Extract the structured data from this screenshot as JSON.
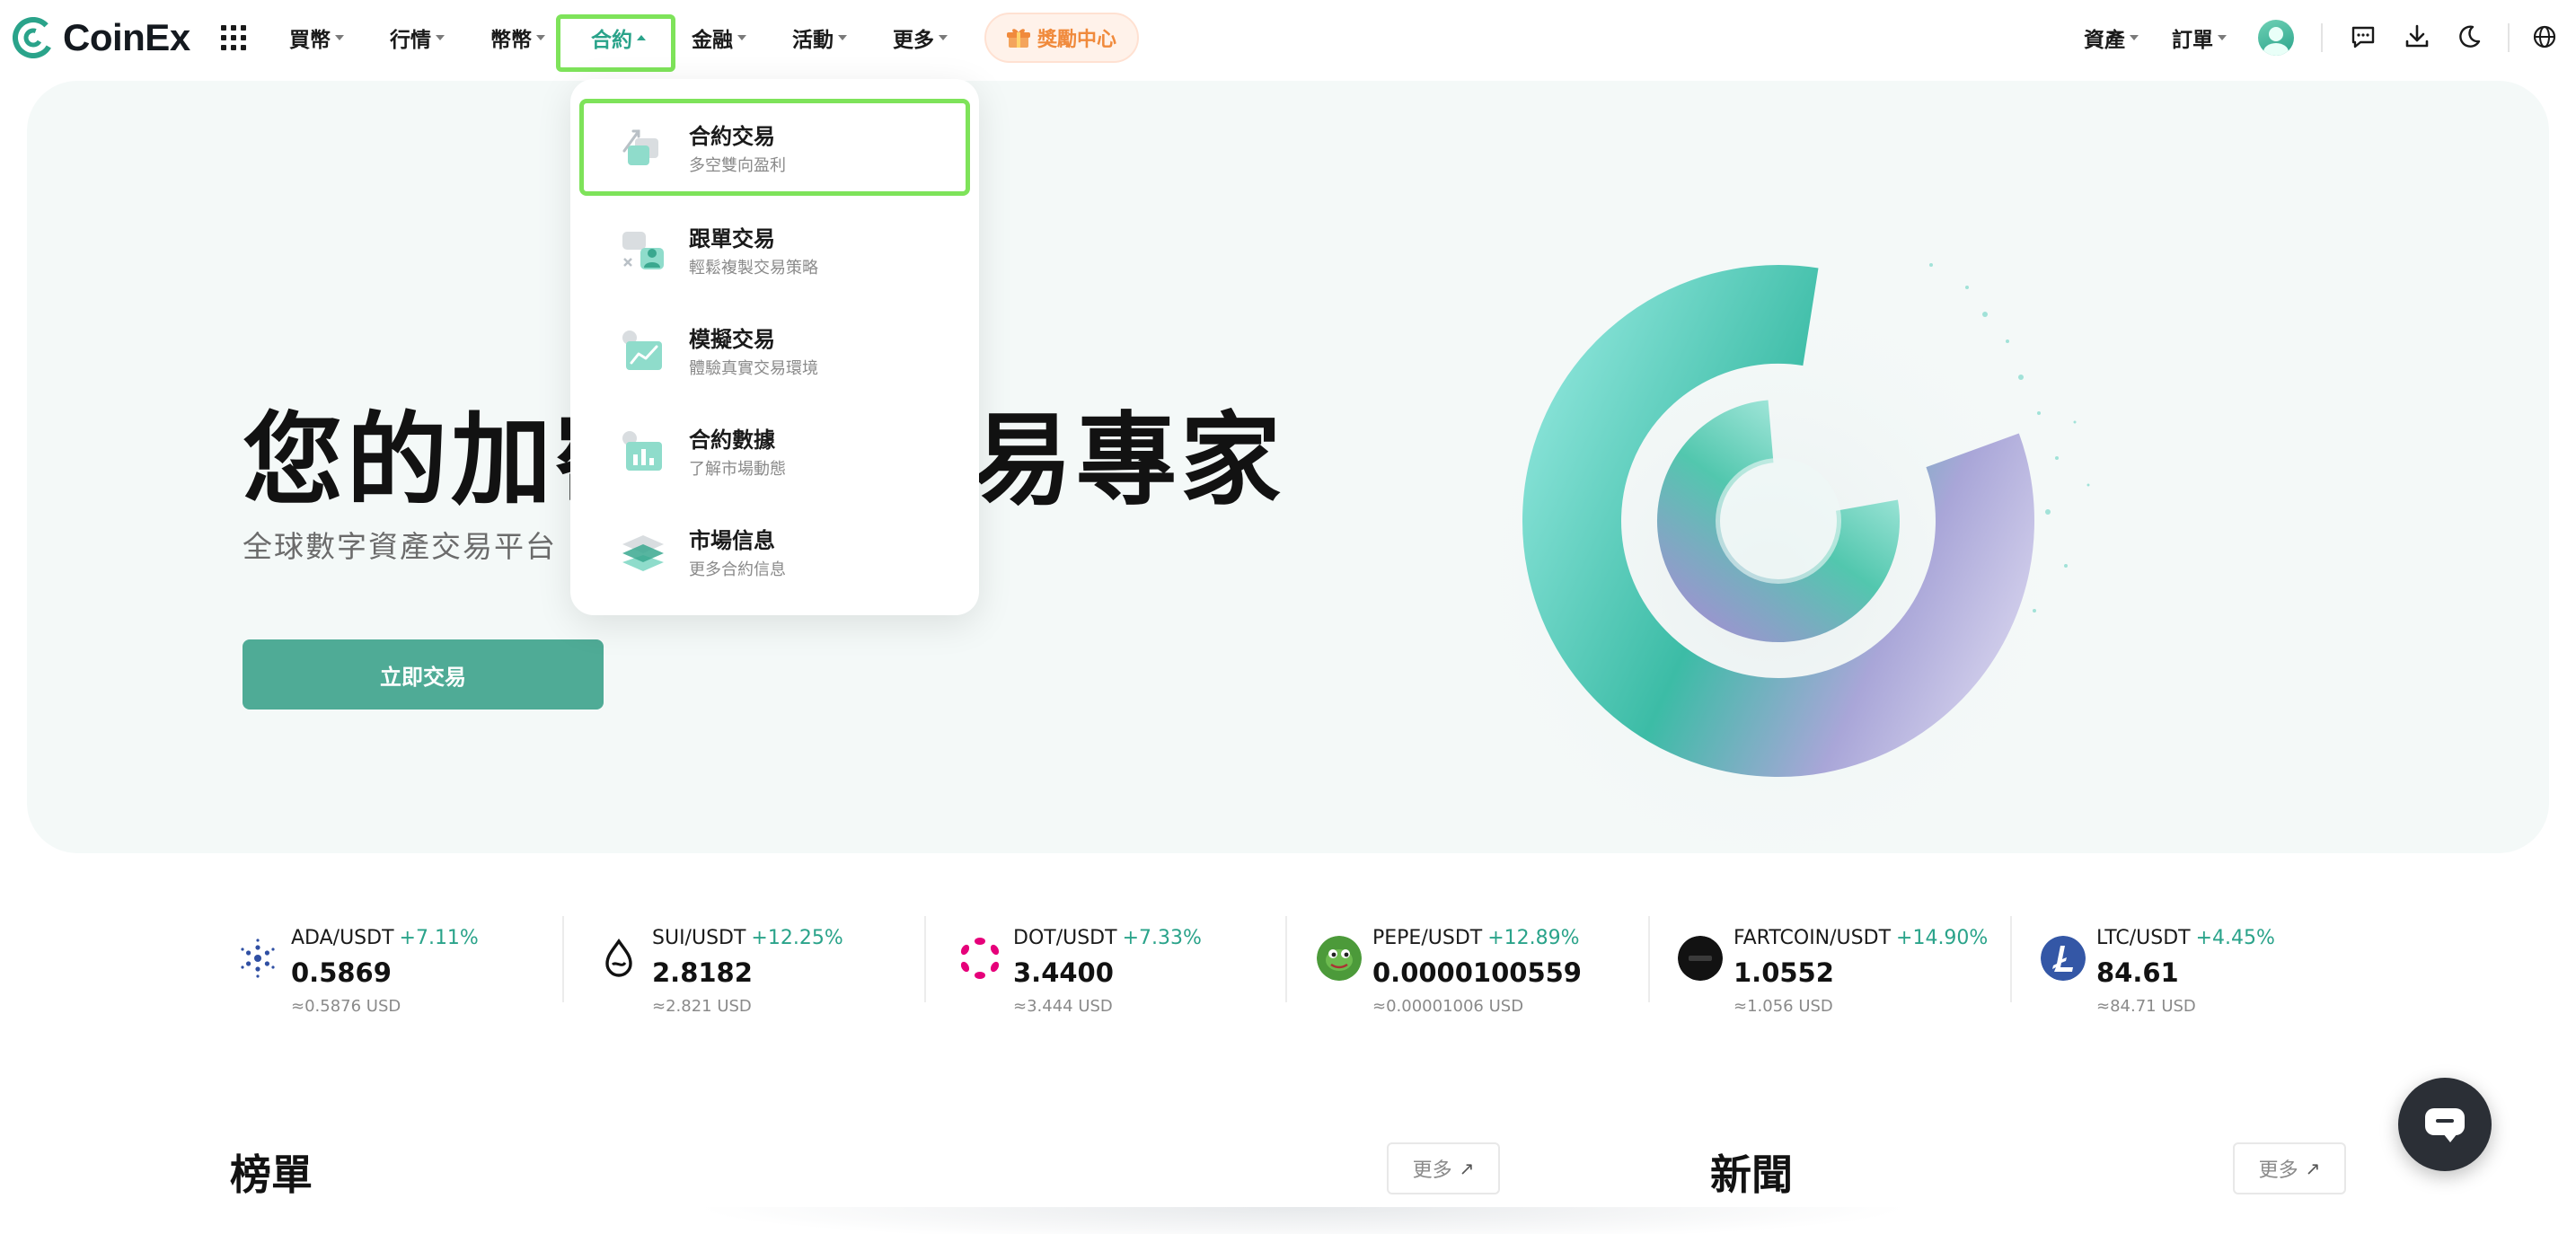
{
  "brand": {
    "name": "CoinEx",
    "accent": "#2aa38a"
  },
  "nav": {
    "items": [
      {
        "label": "買幣",
        "active": false
      },
      {
        "label": "行情",
        "active": false
      },
      {
        "label": "幣幣",
        "active": false
      },
      {
        "label": "合約",
        "active": true
      },
      {
        "label": "金融",
        "active": false
      },
      {
        "label": "活動",
        "active": false
      },
      {
        "label": "更多",
        "active": false
      }
    ],
    "rewards_label": "獎勵中心",
    "right": {
      "assets": "資產",
      "orders": "訂單"
    }
  },
  "dropdown": {
    "items": [
      {
        "title": "合約交易",
        "desc": "多空雙向盈利",
        "icon": "futures-trade-icon",
        "highlighted": true
      },
      {
        "title": "跟單交易",
        "desc": "輕鬆複製交易策略",
        "icon": "copy-trade-icon",
        "highlighted": false
      },
      {
        "title": "模擬交易",
        "desc": "體驗真實交易環境",
        "icon": "demo-trade-icon",
        "highlighted": false
      },
      {
        "title": "合約數據",
        "desc": "了解市場動態",
        "icon": "futures-data-icon",
        "highlighted": false
      },
      {
        "title": "市場信息",
        "desc": "更多合約信息",
        "icon": "market-info-icon",
        "highlighted": false
      }
    ]
  },
  "hero": {
    "title": "您的加密資產交易專家",
    "subtitle": "全球數字資產交易平台",
    "cta": "立即交易"
  },
  "ticker": [
    {
      "pair": "ADA/USDT",
      "change": "+7.11%",
      "price": "0.5869",
      "usd": "≈0.5876 USD",
      "icon": "ada-icon",
      "color": "#2f4fa3"
    },
    {
      "pair": "SUI/USDT",
      "change": "+12.25%",
      "price": "2.8182",
      "usd": "≈2.821 USD",
      "icon": "sui-icon",
      "color": "#121212"
    },
    {
      "pair": "DOT/USDT",
      "change": "+7.33%",
      "price": "3.4400",
      "usd": "≈3.444 USD",
      "icon": "dot-icon",
      "color": "#e6007a"
    },
    {
      "pair": "PEPE/USDT",
      "change": "+12.89%",
      "price": "0.0000100559",
      "usd": "≈0.00001006 USD",
      "icon": "pepe-icon",
      "color": "#4c9a3a"
    },
    {
      "pair": "FARTCOIN/USDT",
      "change": "+14.90%",
      "price": "1.0552",
      "usd": "≈1.056 USD",
      "icon": "fartcoin-icon",
      "color": "#121212"
    },
    {
      "pair": "LTC/USDT",
      "change": "+4.45%",
      "price": "84.61",
      "usd": "≈84.71 USD",
      "icon": "ltc-icon",
      "color": "#3457a6"
    }
  ],
  "sections": {
    "rankings": {
      "title": "榜單",
      "more": "更多"
    },
    "news": {
      "title": "新聞",
      "more": "更多"
    }
  }
}
